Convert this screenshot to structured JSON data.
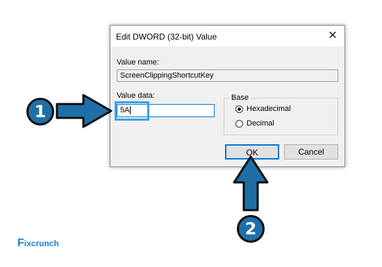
{
  "dialog": {
    "title": "Edit DWORD (32-bit) Value",
    "close_glyph": "✕",
    "value_name_label": "Value name:",
    "value_name": "ScreenClippingShortcutKey",
    "value_data_label": "Value data:",
    "value_data": "5A",
    "base_label": "Base",
    "radio_hex_label": "Hexadecimal",
    "radio_dec_label": "Decimal",
    "selected_base": "Hexadecimal",
    "ok_label": "OK",
    "cancel_label": "Cancel"
  },
  "annotations": {
    "step1": "1",
    "step2": "2",
    "arrow_color": "#1f6fa6",
    "highlight_color": "#3ba0ea"
  },
  "brand": {
    "logo_prefix": "F",
    "logo_mark": "ix",
    "logo_suffix": "crunch",
    "logo_color": "#1f7fd0"
  }
}
